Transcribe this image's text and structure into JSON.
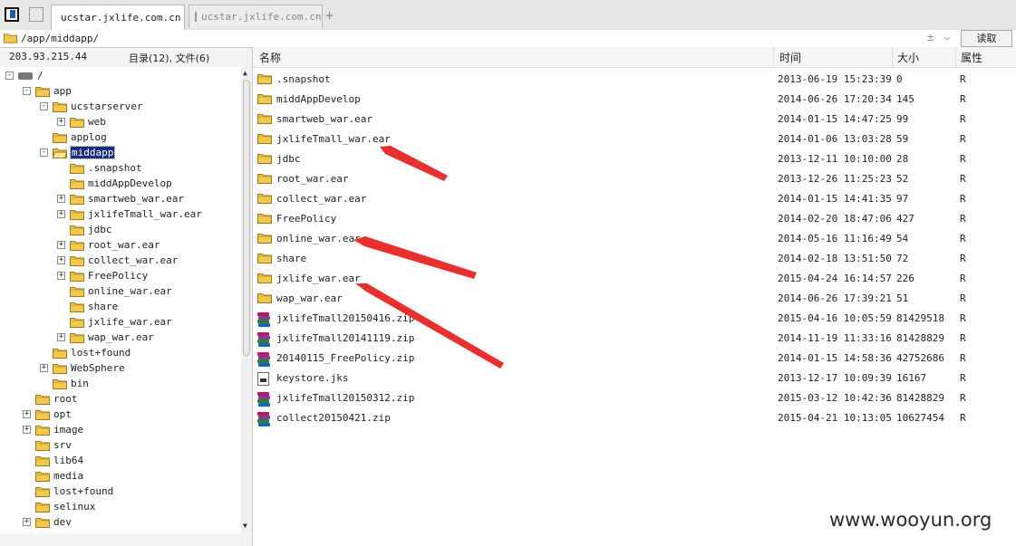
{
  "colors": {
    "accent": "#1a2f7a",
    "folder": "#f2c94c",
    "arrow": "#e8312f"
  },
  "tabs": [
    {
      "label": "ucstar.jxlife.com.cn",
      "active": true
    },
    {
      "label": "ucstar.jxlife.com.cn",
      "active": false
    }
  ],
  "address": {
    "path": "/app/middapp/",
    "read_label": "读取"
  },
  "info": {
    "ip": "203.93.215.44",
    "counts": "目录(12), 文件(6)"
  },
  "columns": {
    "name": "名称",
    "time": "时间",
    "size": "大小",
    "attr": "属性"
  },
  "tree": [
    {
      "label": "/",
      "depth": 0,
      "expander": "-",
      "icon": "drive"
    },
    {
      "label": "app",
      "depth": 1,
      "expander": "-",
      "icon": "folder"
    },
    {
      "label": "ucstarserver",
      "depth": 2,
      "expander": "-",
      "icon": "folder"
    },
    {
      "label": "web",
      "depth": 3,
      "expander": "+",
      "icon": "folder"
    },
    {
      "label": "applog",
      "depth": 2,
      "expander": "",
      "icon": "folder"
    },
    {
      "label": "middapp",
      "depth": 2,
      "expander": "-",
      "icon": "folder-open",
      "selected": true
    },
    {
      "label": ".snapshot",
      "depth": 3,
      "expander": "",
      "icon": "folder"
    },
    {
      "label": "middAppDevelop",
      "depth": 3,
      "expander": "",
      "icon": "folder"
    },
    {
      "label": "smartweb_war.ear",
      "depth": 3,
      "expander": "+",
      "icon": "folder"
    },
    {
      "label": "jxlifeTmall_war.ear",
      "depth": 3,
      "expander": "+",
      "icon": "folder"
    },
    {
      "label": "jdbc",
      "depth": 3,
      "expander": "",
      "icon": "folder"
    },
    {
      "label": "root_war.ear",
      "depth": 3,
      "expander": "+",
      "icon": "folder"
    },
    {
      "label": "collect_war.ear",
      "depth": 3,
      "expander": "+",
      "icon": "folder"
    },
    {
      "label": "FreePolicy",
      "depth": 3,
      "expander": "+",
      "icon": "folder"
    },
    {
      "label": "online_war.ear",
      "depth": 3,
      "expander": "",
      "icon": "folder"
    },
    {
      "label": "share",
      "depth": 3,
      "expander": "",
      "icon": "folder"
    },
    {
      "label": "jxlife_war.ear",
      "depth": 3,
      "expander": "",
      "icon": "folder"
    },
    {
      "label": "wap_war.ear",
      "depth": 3,
      "expander": "+",
      "icon": "folder"
    },
    {
      "label": "lost+found",
      "depth": 2,
      "expander": "",
      "icon": "folder"
    },
    {
      "label": "WebSphere",
      "depth": 2,
      "expander": "+",
      "icon": "folder"
    },
    {
      "label": "bin",
      "depth": 2,
      "expander": "",
      "icon": "folder"
    },
    {
      "label": "root",
      "depth": 1,
      "expander": "",
      "icon": "folder"
    },
    {
      "label": "opt",
      "depth": 1,
      "expander": "+",
      "icon": "folder"
    },
    {
      "label": "image",
      "depth": 1,
      "expander": "+",
      "icon": "folder"
    },
    {
      "label": "srv",
      "depth": 1,
      "expander": "",
      "icon": "folder"
    },
    {
      "label": "lib64",
      "depth": 1,
      "expander": "",
      "icon": "folder"
    },
    {
      "label": "media",
      "depth": 1,
      "expander": "",
      "icon": "folder"
    },
    {
      "label": "lost+found",
      "depth": 1,
      "expander": "",
      "icon": "folder"
    },
    {
      "label": "selinux",
      "depth": 1,
      "expander": "",
      "icon": "folder"
    },
    {
      "label": "dev",
      "depth": 1,
      "expander": "+",
      "icon": "folder"
    }
  ],
  "files": [
    {
      "name": ".snapshot",
      "type": "folder",
      "time": "2013-06-19 15:23:39",
      "size": "0",
      "attr": "R"
    },
    {
      "name": "middAppDevelop",
      "type": "folder",
      "time": "2014-06-26 17:20:34",
      "size": "145",
      "attr": "R"
    },
    {
      "name": "smartweb_war.ear",
      "type": "folder",
      "time": "2014-01-15 14:47:25",
      "size": "99",
      "attr": "R"
    },
    {
      "name": "jxlifeTmall_war.ear",
      "type": "folder",
      "time": "2014-01-06 13:03:28",
      "size": "59",
      "attr": "R"
    },
    {
      "name": "jdbc",
      "type": "folder",
      "time": "2013-12-11 10:10:00",
      "size": "28",
      "attr": "R"
    },
    {
      "name": "root_war.ear",
      "type": "folder",
      "time": "2013-12-26 11:25:23",
      "size": "52",
      "attr": "R"
    },
    {
      "name": "collect_war.ear",
      "type": "folder",
      "time": "2014-01-15 14:41:35",
      "size": "97",
      "attr": "R"
    },
    {
      "name": "FreePolicy",
      "type": "folder",
      "time": "2014-02-20 18:47:06",
      "size": "427",
      "attr": "R"
    },
    {
      "name": "online_war.ear",
      "type": "folder",
      "time": "2014-05-16 11:16:49",
      "size": "54",
      "attr": "R"
    },
    {
      "name": "share",
      "type": "folder",
      "time": "2014-02-18 13:51:50",
      "size": "72",
      "attr": "R"
    },
    {
      "name": "jxlife_war.ear",
      "type": "folder",
      "time": "2015-04-24 16:14:57",
      "size": "226",
      "attr": "R"
    },
    {
      "name": "wap_war.ear",
      "type": "folder",
      "time": "2014-06-26 17:39:21",
      "size": "51",
      "attr": "R"
    },
    {
      "name": "jxlifeTmall20150416.zip",
      "type": "zip",
      "time": "2015-04-16 10:05:59",
      "size": "81429518",
      "attr": "R"
    },
    {
      "name": "jxlifeTmall20141119.zip",
      "type": "zip",
      "time": "2014-11-19 11:33:16",
      "size": "81428829",
      "attr": "R"
    },
    {
      "name": "20140115_FreePolicy.zip",
      "type": "zip",
      "time": "2014-01-15 14:58:36",
      "size": "42752686",
      "attr": "R"
    },
    {
      "name": "keystore.jks",
      "type": "jks",
      "time": "2013-12-17 10:09:39",
      "size": "16167",
      "attr": "R"
    },
    {
      "name": "jxlifeTmall20150312.zip",
      "type": "zip",
      "time": "2015-03-12 10:42:36",
      "size": "81428829",
      "attr": "R"
    },
    {
      "name": "collect20150421.zip",
      "type": "zip",
      "time": "2015-04-21 10:13:05",
      "size": "10627454",
      "attr": "R"
    }
  ],
  "watermark": "www.wooyun.org"
}
